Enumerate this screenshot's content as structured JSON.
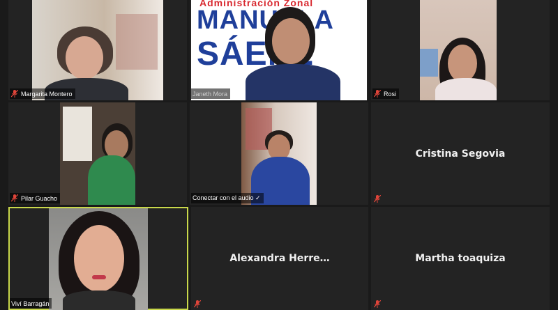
{
  "participants": [
    {
      "name": "Margarita Montero",
      "muted": true,
      "video": true
    },
    {
      "name": "Janeth Mora",
      "muted": true,
      "video": true
    },
    {
      "name": "Rosi",
      "muted": true,
      "video": true
    },
    {
      "name": "Pilar Guacho",
      "muted": true,
      "video": true
    },
    {
      "name": "Conectar con el audio ✓",
      "muted": false,
      "video": true
    },
    {
      "name": "Cristina Segovia",
      "muted": true,
      "video": false
    },
    {
      "name": "Viví Barragán",
      "muted": false,
      "video": true,
      "active_speaker": true
    },
    {
      "name": "Alexandra  Herre…",
      "muted": true,
      "video": false
    },
    {
      "name": "Martha toaquiza",
      "muted": true,
      "video": false
    }
  ],
  "banner": {
    "line1": "Administración Zonal",
    "line2": "MANUELA",
    "line3": "SÁENZ"
  },
  "colors": {
    "background": "#1a1a1a",
    "tile": "#232323",
    "active_border": "#c9d84a",
    "muted_icon": "#e0453a",
    "banner_blue": "#1f3f9a",
    "banner_red": "#d8282f"
  }
}
